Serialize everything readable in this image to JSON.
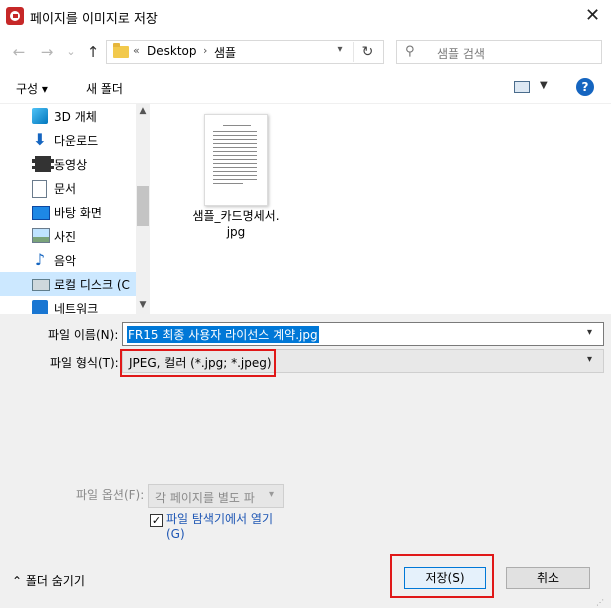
{
  "window": {
    "title": "페이지를 이미지로 저장",
    "close_glyph": "✕"
  },
  "nav": {
    "back_glyph": "←",
    "forward_glyph": "→",
    "recent_glyph": "⌄",
    "up_glyph": "↑",
    "breadcrumb_chevron": "«",
    "breadcrumb": [
      "Desktop",
      "샘플"
    ],
    "breadcrumb_sep": "›",
    "search_placeholder": "샘플 검색"
  },
  "toolbar": {
    "organize": "구성 ▾",
    "new_folder": "새 폴더",
    "help": "?"
  },
  "sidebar": {
    "items": [
      {
        "label": "3D 개체",
        "icon": "cube-3d-icon"
      },
      {
        "label": "다운로드",
        "icon": "download-arrow-icon"
      },
      {
        "label": "동영상",
        "icon": "film-icon"
      },
      {
        "label": "문서",
        "icon": "document-icon"
      },
      {
        "label": "바탕 화면",
        "icon": "desktop-icon"
      },
      {
        "label": "사진",
        "icon": "picture-icon"
      },
      {
        "label": "음악",
        "icon": "music-note-icon"
      },
      {
        "label": "로컬 디스크 (C",
        "icon": "drive-icon",
        "selected": true
      },
      {
        "label": "네트워크",
        "icon": "network-icon"
      }
    ]
  },
  "files": [
    {
      "name_line1": "샘플_카드명세서.",
      "name_line2": "jpg",
      "icon": "image-thumbnail-icon"
    }
  ],
  "form": {
    "filename_label": "파일 이름(N):",
    "filename_value": "FR15 최종 사용자 라이선스 계약.jpg",
    "filetype_label": "파일 형식(T):",
    "filetype_value": "JPEG, 컬러 (*.jpg; *.jpeg)",
    "fileoptions_label": "파일 옵션(F):",
    "fileoptions_value": "각 페이지를 별도 파",
    "open_explorer_label_1": "파일 탐색기에서 열기",
    "open_explorer_label_2": "(G)",
    "open_explorer_checked": true,
    "check_glyph": "✓"
  },
  "buttons": {
    "hide_folders": "⌃ 폴더 숨기기",
    "save": "저장(S)",
    "cancel": "취소"
  },
  "colors": {
    "accent": "#0078d7",
    "highlight_box": "#e01818",
    "link": "#1e56b4"
  }
}
